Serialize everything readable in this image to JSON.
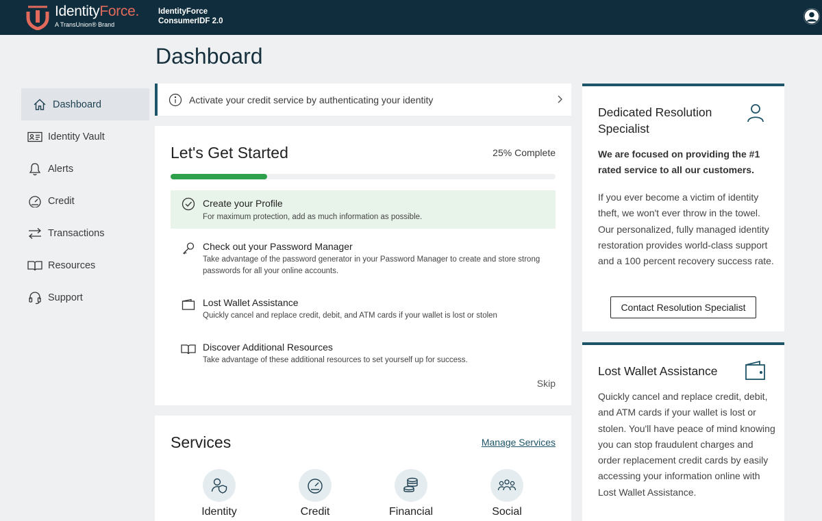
{
  "topbar": {
    "brand_identity": "Identity",
    "brand_force": "Force",
    "brand_mark": ".",
    "brand_sub": "A TransUnion® Brand",
    "product_line1": "IdentityForce",
    "product_line2": "ConsumerIDF 2.0"
  },
  "page": {
    "title": "Dashboard"
  },
  "sidebar": {
    "items": [
      {
        "label": "Dashboard",
        "icon": "home-icon",
        "active": true
      },
      {
        "label": "Identity Vault",
        "icon": "id-card-icon"
      },
      {
        "label": "Alerts",
        "icon": "bell-icon"
      },
      {
        "label": "Credit",
        "icon": "gauge-icon"
      },
      {
        "label": "Transactions",
        "icon": "arrows-icon"
      },
      {
        "label": "Resources",
        "icon": "book-icon"
      },
      {
        "label": "Support",
        "icon": "headset-icon"
      }
    ]
  },
  "alert": {
    "text": "Activate your credit service by authenticating your identity"
  },
  "started": {
    "title": "Let's Get Started",
    "percent_label": "25% Complete",
    "progress": 0.25,
    "tasks": [
      {
        "title": "Create your Profile",
        "desc": "For maximum protection, add as much information as possible.",
        "done": true,
        "icon": "check-circle-icon"
      },
      {
        "title": "Check out your Password Manager",
        "desc": "Take advantage of the password generator in your Password Manager to create and store strong passwords for all your online accounts.",
        "icon": "key-icon"
      },
      {
        "title": "Lost Wallet Assistance",
        "desc": "Quickly cancel and replace credit, debit, and ATM cards if your wallet is lost or stolen",
        "icon": "wallet-icon"
      },
      {
        "title": "Discover Additional Resources",
        "desc": "Take advantage of these additional resources to set yourself up for success.",
        "icon": "book-icon"
      }
    ],
    "skip": "Skip"
  },
  "services": {
    "title": "Services",
    "manage": "Manage Services",
    "items": [
      {
        "label": "Identity",
        "icon": "identity-shield-icon"
      },
      {
        "label": "Credit",
        "icon": "gauge-icon"
      },
      {
        "label": "Financial",
        "icon": "coins-icon"
      },
      {
        "label": "Social",
        "icon": "people-icon"
      }
    ]
  },
  "specialist": {
    "title": "Dedicated Resolution Specialist",
    "bold": "We are focused on providing the #1 rated service to all our customers.",
    "body": "If you ever become a victim of identity theft, we won't ever throw in the towel. Our personalized, fully managed identity restoration provides world-class support and a 100 percent recovery success rate.",
    "button": "Contact Resolution Specialist"
  },
  "wallet": {
    "title": "Lost Wallet Assistance",
    "body": "Quickly cancel and replace credit, debit, and ATM cards if your wallet is lost or stolen. You'll have peace of mind knowing you can stop fraudulent charges and order replacement credit cards by easily accessing your information online with Lost Wallet Assistance."
  },
  "colors": {
    "topbar": "#0f2d3c",
    "accent": "#1d5468",
    "progress": "#2ea04b",
    "brand_red": "#e26a5c"
  }
}
